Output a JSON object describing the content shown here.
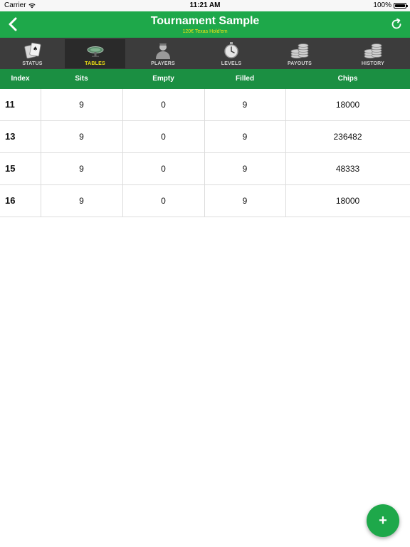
{
  "status_bar": {
    "carrier": "Carrier",
    "time": "11:21 AM",
    "battery": "100%"
  },
  "header": {
    "title": "Tournament Sample",
    "subtitle": "120€ Texas Hold'em",
    "back_icon": "chevron-left-icon",
    "refresh_icon": "refresh-icon"
  },
  "tabs": [
    {
      "label": "STATUS",
      "icon": "playing-cards-icon",
      "active": false
    },
    {
      "label": "TABLES",
      "icon": "poker-table-icon",
      "active": true
    },
    {
      "label": "PLAYERS",
      "icon": "player-silhouette-icon",
      "active": false
    },
    {
      "label": "LEVELS",
      "icon": "timer-clock-icon",
      "active": false
    },
    {
      "label": "PAYOUTS",
      "icon": "chip-stack-icon",
      "active": false
    },
    {
      "label": "HISTORY",
      "icon": "chip-stack-icon",
      "active": false
    }
  ],
  "table": {
    "columns": [
      "Index",
      "Sits",
      "Empty",
      "Filled",
      "Chips"
    ],
    "rows": [
      [
        "11",
        "9",
        "0",
        "9",
        "18000"
      ],
      [
        "13",
        "9",
        "0",
        "9",
        "236482"
      ],
      [
        "15",
        "9",
        "0",
        "9",
        "48333"
      ],
      [
        "16",
        "9",
        "0",
        "9",
        "18000"
      ]
    ]
  },
  "fab": {
    "label": "+"
  },
  "colors": {
    "primary_green": "#1ea84a",
    "header_green": "#1b8f42",
    "tab_bg": "#3c3c3c",
    "active_tab_text": "#f2e313"
  }
}
